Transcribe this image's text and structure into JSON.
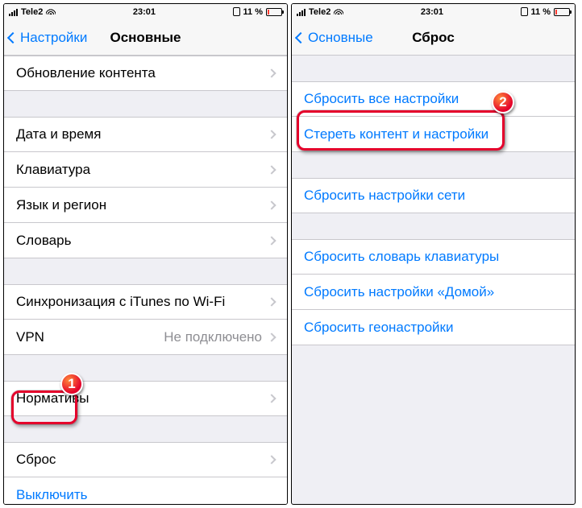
{
  "status": {
    "carrier": "Tele2",
    "time": "23:01",
    "battery_text": "11 %"
  },
  "left": {
    "back_label": "Настройки",
    "title": "Основные",
    "rows": {
      "content_update": "Обновление контента",
      "date_time": "Дата и время",
      "keyboard": "Клавиатура",
      "lang_region": "Язык и регион",
      "dictionary": "Словарь",
      "itunes_wifi": "Синхронизация с iTunes по Wi-Fi",
      "vpn": "VPN",
      "vpn_value": "Не подключено",
      "norms": "Нормативы",
      "reset": "Сброс",
      "shutdown": "Выключить"
    }
  },
  "right": {
    "back_label": "Основные",
    "title": "Сброс",
    "rows": {
      "reset_all": "Сбросить все настройки",
      "erase_all": "Стереть контент и настройки",
      "reset_network": "Сбросить настройки сети",
      "reset_keyboard": "Сбросить словарь клавиатуры",
      "reset_home": "Сбросить настройки «Домой»",
      "reset_geo": "Сбросить геонастройки"
    }
  },
  "markers": {
    "one": "1",
    "two": "2"
  }
}
